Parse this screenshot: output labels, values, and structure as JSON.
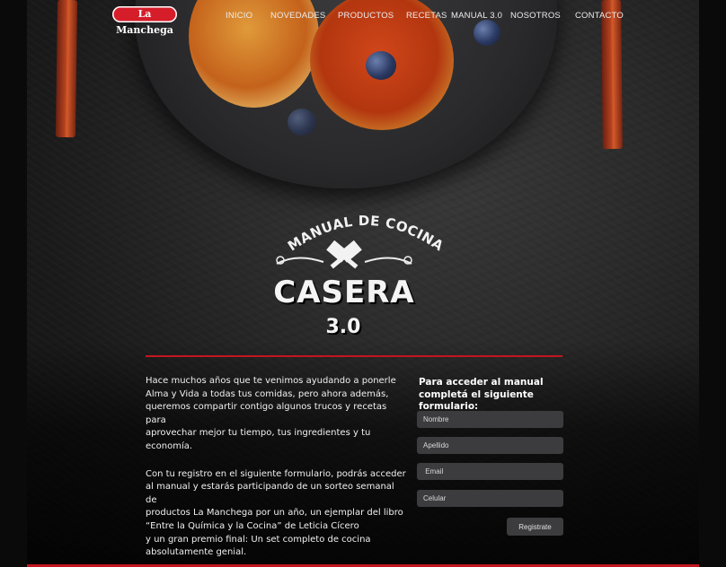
{
  "brand": {
    "logo_text": "La Manchega",
    "accent": "#c2161f"
  },
  "nav": {
    "items": [
      "INICIO",
      "NOVEDADES",
      "PRODUCTOS",
      "RECETAS",
      "MANUAL 3.0",
      "NOSOTROS",
      "CONTACTO"
    ]
  },
  "emblem": {
    "top_arc": "MANUAL DE COCINA",
    "title": "CASERA",
    "version": "3.0",
    "icon": "crossed-cleavers-icon"
  },
  "intro": {
    "p1": "Hace muchos años que te venimos ayudando a ponerle Alma y Vida a todas tus comidas, pero ahora además, queremos compartir contigo algunos trucos y recetas para aprovechar mejor tu tiempo, tus ingredientes y tu economía.",
    "p2_lines": [
      "Con tu registro en el siguiente formulario, podrás acceder",
      "al manual y estarás participando de un sorteo semanal de",
      "productos La Manchega por un año, un ejemplar del libro",
      "“Entre la Química y la Cocina” de Leticia Cícero",
      "y un gran premio final: Un set completo de cocina",
      "absolutamente genial."
    ],
    "p1_lines": [
      "Hace muchos años que te venimos ayudando a ponerle",
      "Alma y Vida a todas tus comidas, pero ahora además,",
      "queremos compartir contigo algunos trucos y recetas para",
      "aprovechar mejor tu tiempo, tus ingredientes y tu economía."
    ]
  },
  "form": {
    "title_line1": "Para acceder al manual",
    "title_line2": "completá el siguiente formulario:",
    "fields": [
      {
        "placeholder": "Nombre",
        "value": ""
      },
      {
        "placeholder": "Apellido",
        "value": ""
      },
      {
        "placeholder": " Email",
        "value": ""
      },
      {
        "placeholder": "Celular",
        "value": ""
      }
    ],
    "submit_label": "Registrate"
  }
}
